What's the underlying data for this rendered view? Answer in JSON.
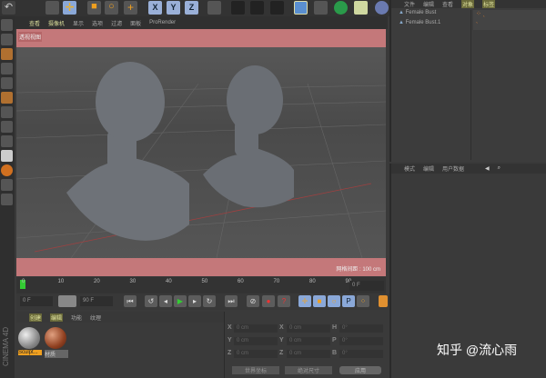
{
  "viewport": {
    "menu": [
      "查看",
      "摄像机",
      "显示",
      "选项",
      "过滤",
      "面板",
      "ProRender"
    ],
    "view_label": "透视视图",
    "grid_spacing": "网格间距 : 100 cm"
  },
  "toolbar": {
    "axes": [
      "X",
      "Y",
      "Z"
    ]
  },
  "timeline": {
    "ticks": [
      "0",
      "10",
      "20",
      "30",
      "40",
      "50",
      "60",
      "70",
      "80",
      "90"
    ],
    "current_frame": "0 F"
  },
  "controls": {
    "start": "0 F",
    "end": "90 F"
  },
  "object_manager": {
    "menu": [
      "文件",
      "编辑",
      "查看",
      "对象",
      "标签"
    ],
    "objects": [
      "Female Bust",
      "Female Bust.1"
    ]
  },
  "attributes": {
    "menu": [
      "模式",
      "编辑",
      "用户数据"
    ]
  },
  "materials": {
    "menu": [
      "创建",
      "编辑",
      "功能",
      "纹理"
    ],
    "items": [
      "Sculpt...",
      "材质"
    ]
  },
  "coordinates": {
    "rows": [
      {
        "a": "X",
        "v1": "0 cm",
        "b": "X",
        "v2": "0 cm",
        "c": "H",
        "v3": "0°"
      },
      {
        "a": "Y",
        "v1": "0 cm",
        "b": "Y",
        "v2": "0 cm",
        "c": "P",
        "v3": "0°"
      },
      {
        "a": "Z",
        "v1": "0 cm",
        "b": "Z",
        "v2": "0 cm",
        "c": "B",
        "v3": "0°"
      }
    ],
    "mode": "世界坐标",
    "size": "绝对尺寸",
    "apply": "应用"
  },
  "brand": "CINEMA 4D",
  "watermark": "知乎 @流心雨"
}
